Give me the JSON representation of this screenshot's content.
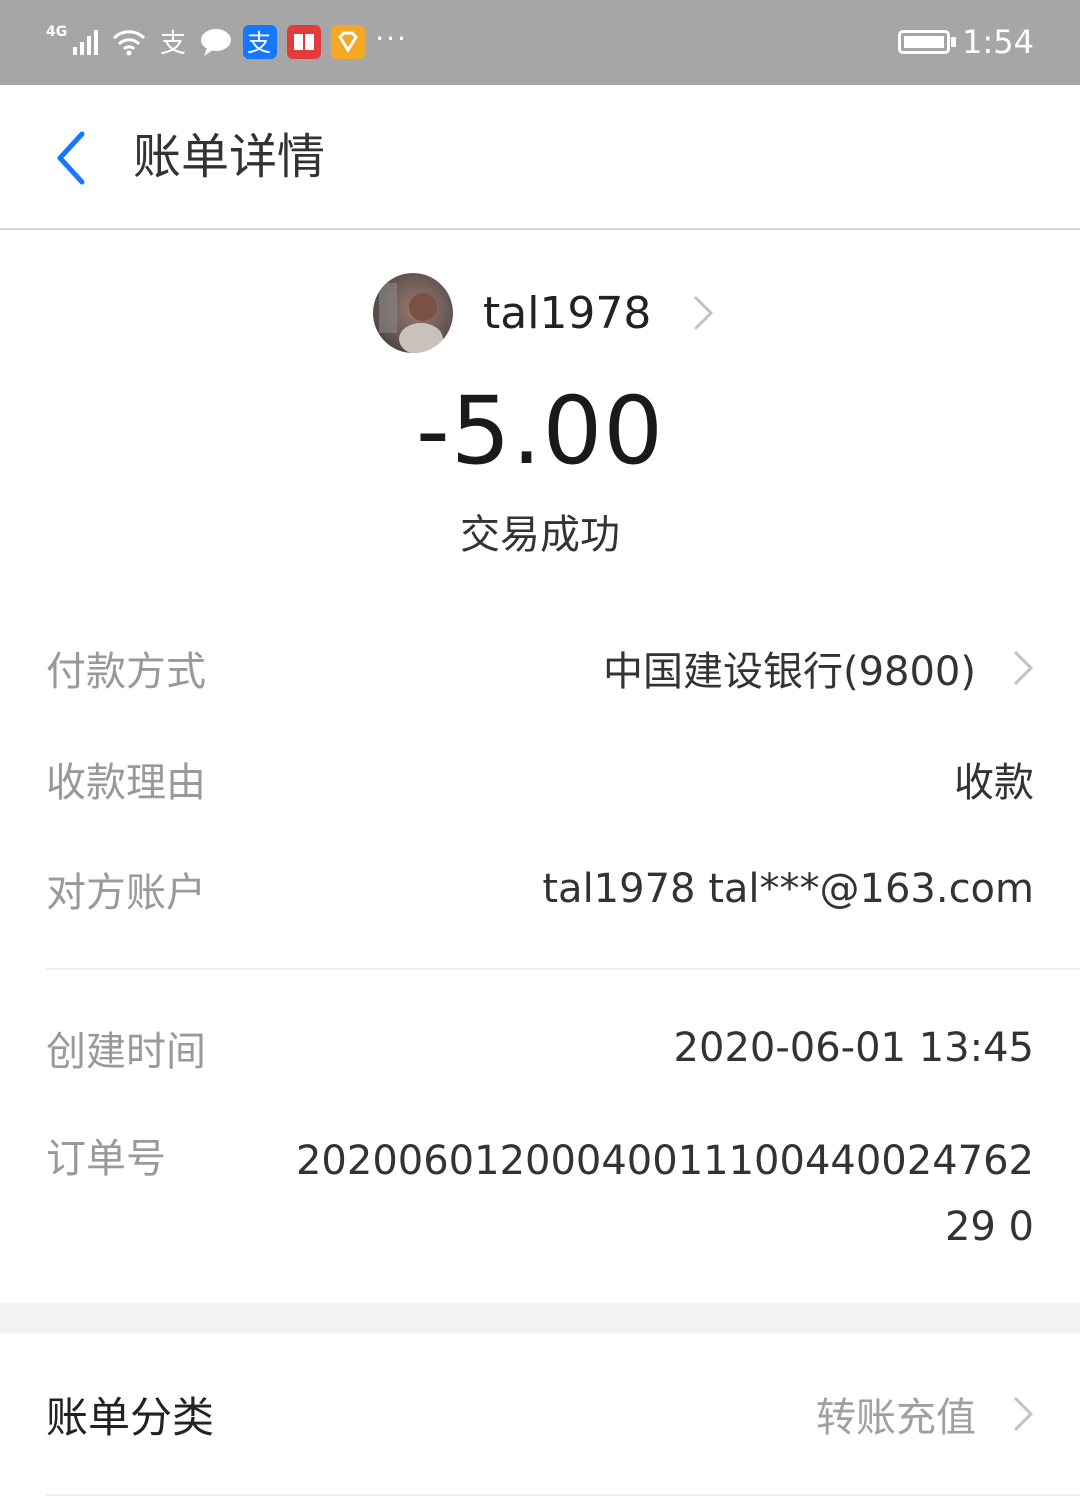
{
  "status_bar": {
    "network": "4G",
    "time": "1:54",
    "app_icons": [
      "alipay-icon",
      "message-icon",
      "alipay-blue-icon",
      "book-icon",
      "diamond-icon"
    ],
    "more": "···"
  },
  "nav": {
    "title": "账单详情"
  },
  "header": {
    "payee_name": "tal1978",
    "amount": "-5.00",
    "status": "交易成功"
  },
  "details": {
    "payment_method": {
      "label": "付款方式",
      "value": "中国建设银行(9800)"
    },
    "reason": {
      "label": "收款理由",
      "value": "收款"
    },
    "counterparty": {
      "label": "对方账户",
      "value": "tal1978 tal***@163.com"
    },
    "created": {
      "label": "创建时间",
      "value": "2020-06-01 13:45"
    },
    "order": {
      "label": "订单号",
      "value": "2020060120004001110044002476229 0"
    }
  },
  "category": {
    "label": "账单分类",
    "value": "转账充值"
  },
  "colors": {
    "accent_blue": "#1677ff",
    "status_bar": "#a6a6a6"
  }
}
